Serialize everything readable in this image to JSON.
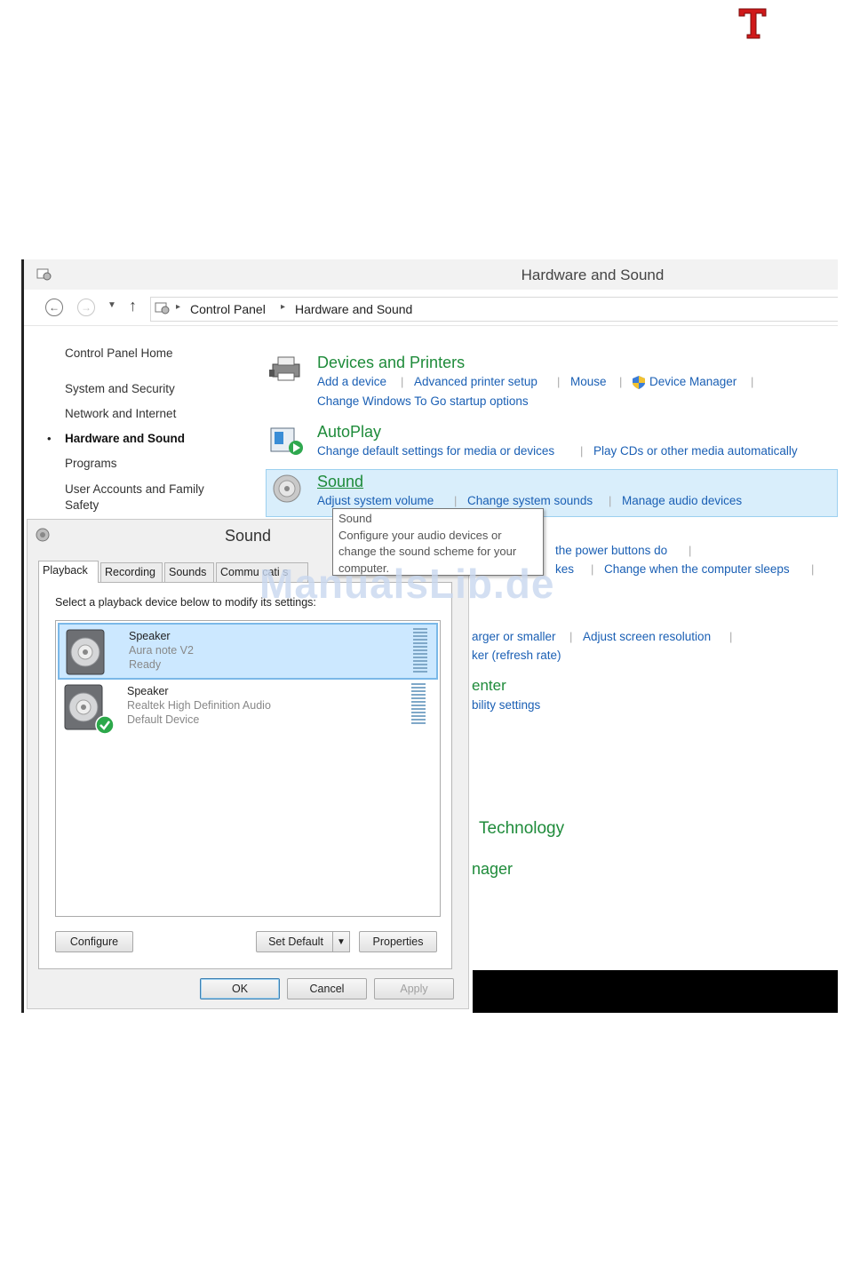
{
  "logo": {
    "letter": "T",
    "color": "#d0191a"
  },
  "window": {
    "title": "Hardware and Sound",
    "breadcrumb": [
      "Control Panel",
      "Hardware and Sound"
    ]
  },
  "sidebar": {
    "items": [
      {
        "label": "Control Panel Home"
      },
      {
        "label": "System and Security"
      },
      {
        "label": "Network and Internet"
      },
      {
        "label": "Hardware and Sound",
        "current": true
      },
      {
        "label": "Programs"
      },
      {
        "label": "User Accounts and Family Safety"
      }
    ]
  },
  "categories": {
    "devices": {
      "title": "Devices and Printers",
      "tasks": [
        "Add a device",
        "Advanced printer setup",
        "Mouse",
        "Device Manager",
        "Change Windows To Go startup options"
      ]
    },
    "autoplay": {
      "title": "AutoPlay",
      "tasks": [
        "Change default settings for media or devices",
        "Play CDs or other media automatically"
      ]
    },
    "sound": {
      "title": "Sound",
      "tasks": [
        "Adjust system volume",
        "Change system sounds",
        "Manage audio devices"
      ]
    },
    "power_partial": {
      "tasks": [
        "the power buttons do",
        "kes",
        "Change when the computer sleeps"
      ]
    },
    "display_partial": {
      "tasks": [
        "arger or smaller",
        "Adjust screen resolution",
        "ker (refresh rate)"
      ]
    },
    "ease_partial": {
      "title": "enter",
      "task": "bility settings"
    },
    "tech_partial": {
      "title": "Technology"
    },
    "manager_partial": {
      "title": "nager"
    }
  },
  "tooltip": {
    "title": "Sound",
    "lines": [
      "Configure your audio devices or",
      "change the sound scheme for your",
      "computer."
    ]
  },
  "dialog": {
    "title": "Sound",
    "tabs": [
      "Playback",
      "Recording",
      "Sounds",
      "Commu  cati  s"
    ],
    "instruction": "Select a playback device below to modify its settings:",
    "devices": [
      {
        "name": "Speaker",
        "driver": "Aura note V2",
        "status": "Ready",
        "selected": true
      },
      {
        "name": "Speaker",
        "driver": "Realtek High Definition Audio",
        "status": "Default Device",
        "selected": false
      }
    ],
    "buttons": {
      "configure": "Configure",
      "set_default": "Set Default",
      "properties": "Properties",
      "ok": "OK",
      "cancel": "Cancel",
      "apply": "Apply"
    }
  },
  "watermark": "ManualsLib.de",
  "colors": {
    "link": "#1a5fb4",
    "category": "#1e8b3a",
    "selection": "#cce8ff",
    "watermark": "#c9d8ef"
  }
}
